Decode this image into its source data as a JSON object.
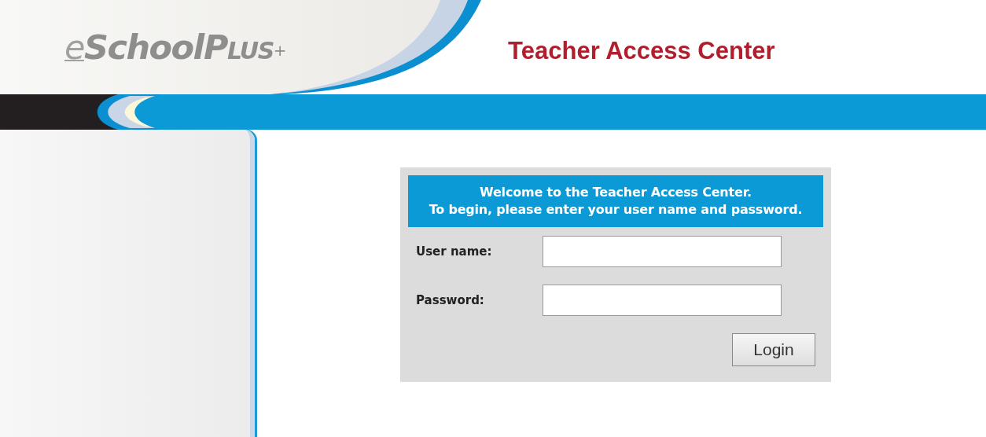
{
  "header": {
    "logo": {
      "prefix": "e",
      "name": "School",
      "suffix": "Plus",
      "mark": "+"
    },
    "title": "Teacher Access Center"
  },
  "login": {
    "welcome": [
      "Welcome to the Teacher Access Center.",
      "To begin, please enter your user name and password."
    ],
    "fields": [
      {
        "label": "User name:"
      },
      {
        "label": "Password:"
      }
    ],
    "button": "Login"
  }
}
